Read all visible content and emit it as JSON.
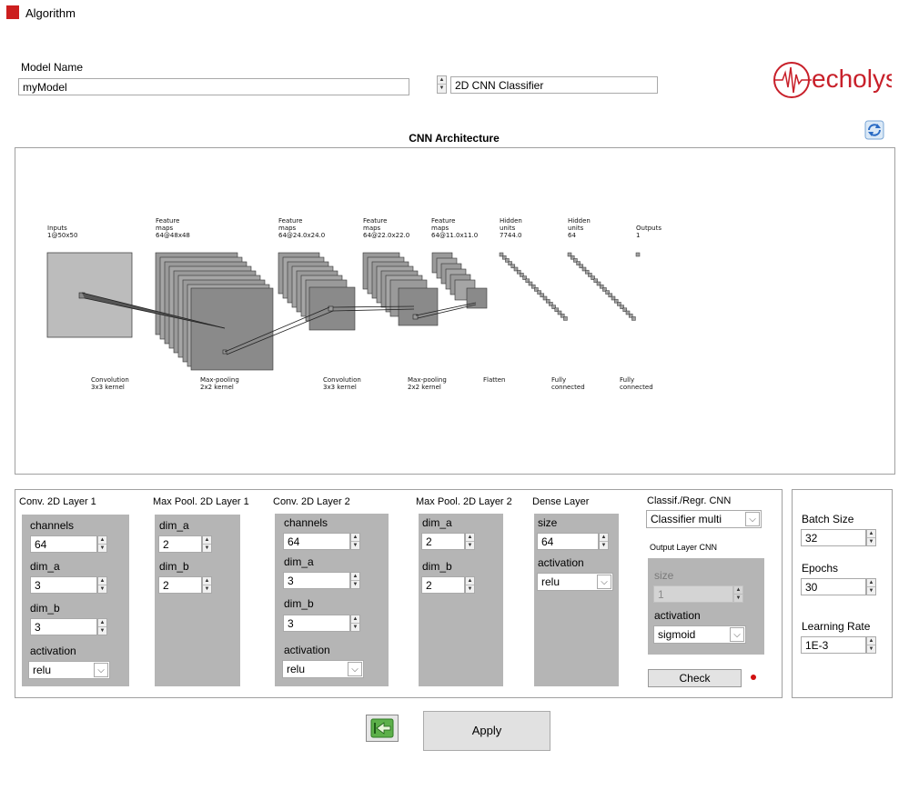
{
  "window": {
    "title": "Algorithm",
    "app_icon": "swiss-app-icon"
  },
  "model_name": {
    "label": "Model Name",
    "value": "myModel"
  },
  "model_type": {
    "value": "2D CNN Classifier"
  },
  "logo": {
    "text": "echolyst",
    "color": "#c8202a"
  },
  "refresh_icon": "refresh-icon",
  "architecture": {
    "title": "CNN Architecture",
    "top_labels": [
      {
        "l1": "Inputs",
        "l2": "1@50x50"
      },
      {
        "l1": "Feature",
        "l2": "maps",
        "l3": "64@48x48"
      },
      {
        "l1": "Feature",
        "l2": "maps",
        "l3": "64@24.0x24.0"
      },
      {
        "l1": "Feature",
        "l2": "maps",
        "l3": "64@22.0x22.0"
      },
      {
        "l1": "Feature",
        "l2": "maps",
        "l3": "64@11.0x11.0"
      },
      {
        "l1": "Hidden",
        "l2": "units",
        "l3": "7744.0"
      },
      {
        "l1": "Hidden",
        "l2": "units",
        "l3": "64"
      },
      {
        "l1": "Outputs",
        "l2": "1"
      }
    ],
    "bottom_labels": [
      {
        "l1": "Convolution",
        "l2": "3x3 kernel"
      },
      {
        "l1": "Max-pooling",
        "l2": "2x2 kernel"
      },
      {
        "l1": "Convolution",
        "l2": "3x3 kernel"
      },
      {
        "l1": "Max-pooling",
        "l2": "2x2 kernel"
      },
      {
        "l1": "Flatten",
        "l2": ""
      },
      {
        "l1": "Fully",
        "l2": "connected"
      },
      {
        "l1": "Fully",
        "l2": "connected"
      }
    ]
  },
  "conv1": {
    "title": "Conv. 2D Layer 1",
    "channels_label": "channels",
    "channels": "64",
    "dim_a_label": "dim_a",
    "dim_a": "3",
    "dim_b_label": "dim_b",
    "dim_b": "3",
    "activation_label": "activation",
    "activation": "relu"
  },
  "pool1": {
    "title": "Max Pool. 2D Layer  1",
    "dim_a_label": "dim_a",
    "dim_a": "2",
    "dim_b_label": "dim_b",
    "dim_b": "2"
  },
  "conv2": {
    "title": "Conv. 2D Layer 2",
    "channels_label": "channels",
    "channels": "64",
    "dim_a_label": "dim_a",
    "dim_a": "3",
    "dim_b_label": "dim_b",
    "dim_b": "3",
    "activation_label": "activation",
    "activation": "relu"
  },
  "pool2": {
    "title": "Max Pool. 2D Layer  2",
    "dim_a_label": "dim_a",
    "dim_a": "2",
    "dim_b_label": "dim_b",
    "dim_b": "2"
  },
  "dense": {
    "title": "Dense Layer",
    "size_label": "size",
    "size": "64",
    "activation_label": "activation",
    "activation": "relu"
  },
  "classif": {
    "title": "Classif./Regr. CNN",
    "type": "Classifier multi",
    "output_title": "Output Layer CNN",
    "size_label": "size",
    "size": "1",
    "activation_label": "activation",
    "activation": "sigmoid",
    "check_label": "Check",
    "status_color": "#d11010"
  },
  "training": {
    "batch_label": "Batch Size",
    "batch": "32",
    "epochs_label": "Epochs",
    "epochs": "30",
    "lr_label": "Learning Rate",
    "lr": "1E-3"
  },
  "footer": {
    "back_icon": "back-arrow-icon",
    "apply_label": "Apply"
  }
}
